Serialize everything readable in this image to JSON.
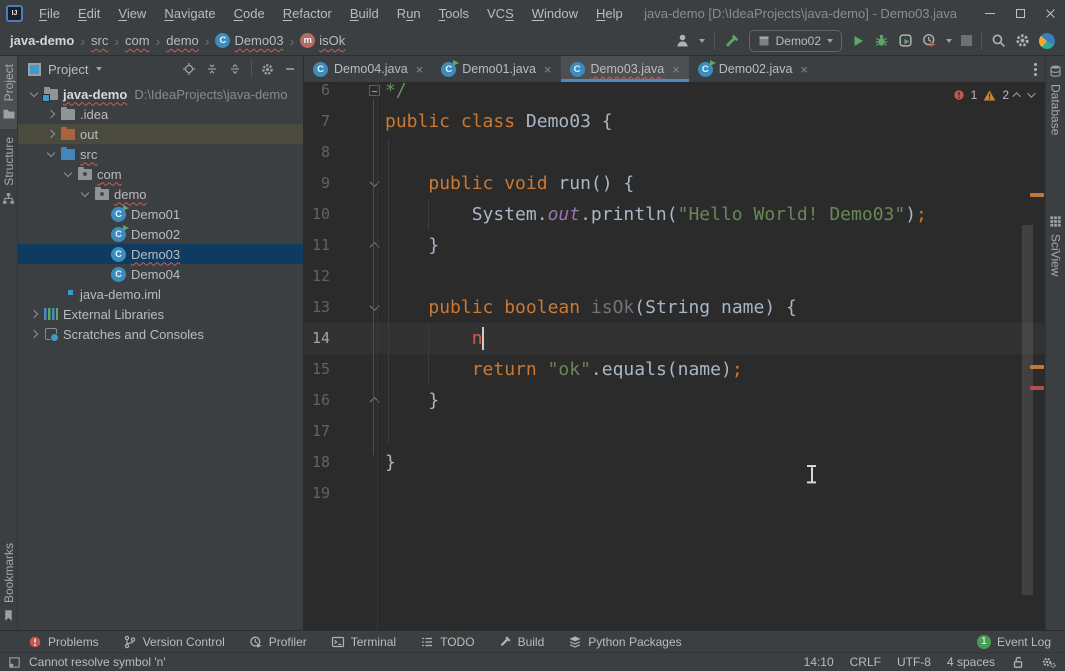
{
  "window": {
    "title": "java-demo [D:\\IdeaProjects\\java-demo] - Demo03.java"
  },
  "menu": {
    "items": [
      {
        "label": "File",
        "m": 0
      },
      {
        "label": "Edit",
        "m": 0
      },
      {
        "label": "View",
        "m": 0
      },
      {
        "label": "Navigate",
        "m": 0
      },
      {
        "label": "Code",
        "m": 0
      },
      {
        "label": "Refactor",
        "m": 0
      },
      {
        "label": "Build",
        "m": 0
      },
      {
        "label": "Run",
        "m": 1
      },
      {
        "label": "Tools",
        "m": 0
      },
      {
        "label": "VCS",
        "m": 2
      },
      {
        "label": "Window",
        "m": 0
      },
      {
        "label": "Help",
        "m": 0
      }
    ]
  },
  "breadcrumbs": [
    {
      "label": "java-demo",
      "bold": true
    },
    {
      "label": "src",
      "sq": true
    },
    {
      "label": "com",
      "sq": true
    },
    {
      "label": "demo",
      "sq": true
    },
    {
      "label": "Demo03",
      "icon": "class",
      "sq": true
    },
    {
      "label": "isOk",
      "icon": "method",
      "sq": true
    }
  ],
  "toolbar": {
    "run_config": "Demo02"
  },
  "left_stripe": {
    "top": [
      {
        "label": "Project",
        "icon": "project-tool",
        "active": true
      },
      {
        "label": "Structure",
        "icon": "structure"
      }
    ],
    "bottom": [
      {
        "label": "Bookmarks",
        "icon": "bookmarks"
      }
    ]
  },
  "right_stripe": [
    {
      "label": "Database",
      "icon": "database"
    },
    {
      "label": "SciView",
      "icon": "grid"
    }
  ],
  "project_panel": {
    "title": "Project",
    "tree": [
      {
        "label": "java-demo",
        "level": 0,
        "chevron": "open",
        "icon": "project",
        "bold": true,
        "sq": true,
        "suffix": "D:\\IdeaProjects\\java-demo"
      },
      {
        "label": ".idea",
        "level": 1,
        "chevron": "closed",
        "icon": "folder"
      },
      {
        "label": "out",
        "level": 1,
        "chevron": "closed",
        "icon": "folder-excluded",
        "highlight": true
      },
      {
        "label": "src",
        "level": 1,
        "chevron": "open",
        "icon": "folder-source",
        "sq": true
      },
      {
        "label": "com",
        "level": 2,
        "chevron": "open",
        "icon": "package",
        "sq": true
      },
      {
        "label": "demo",
        "level": 3,
        "chevron": "open",
        "icon": "package",
        "sq": true
      },
      {
        "label": "Demo01",
        "level": 4,
        "icon": "class-run"
      },
      {
        "label": "Demo02",
        "level": 4,
        "icon": "class-run"
      },
      {
        "label": "Demo03",
        "level": 4,
        "icon": "class",
        "selected": true,
        "sq": true
      },
      {
        "label": "Demo04",
        "level": 4,
        "icon": "class"
      },
      {
        "label": "java-demo.iml",
        "level": 1,
        "icon": "iml"
      },
      {
        "label": "External Libraries",
        "level": 0,
        "chevron": "closed",
        "icon": "libraries"
      },
      {
        "label": "Scratches and Consoles",
        "level": 0,
        "chevron": "closed",
        "icon": "scratches"
      }
    ]
  },
  "tabs": [
    {
      "label": "Demo04.java",
      "icon": "class"
    },
    {
      "label": "Demo01.java",
      "icon": "class-run"
    },
    {
      "label": "Demo03.java",
      "icon": "class",
      "active": true,
      "sq": true
    },
    {
      "label": "Demo02.java",
      "icon": "class-run"
    }
  ],
  "editor": {
    "inspection": {
      "errors": "1",
      "warnings": "2"
    },
    "lines": [
      {
        "no": "6",
        "fold": "box",
        "segs": [
          [
            "cmt",
            "*/"
          ]
        ]
      },
      {
        "no": "7",
        "segs": [
          [
            "kw",
            "public class "
          ],
          [
            "def",
            "Demo03 {"
          ]
        ]
      },
      {
        "no": "8",
        "segs": []
      },
      {
        "no": "9",
        "fold": "open",
        "segs": [
          [
            "def",
            "    "
          ],
          [
            "kw",
            "public void "
          ],
          [
            "def",
            "run() {"
          ]
        ]
      },
      {
        "no": "10",
        "segs": [
          [
            "def",
            "        System."
          ],
          [
            "field",
            "out"
          ],
          [
            "def",
            ".println("
          ],
          [
            "str",
            "\"Hello World! Demo03\""
          ],
          [
            "def",
            ")"
          ],
          [
            "semi",
            ";"
          ]
        ]
      },
      {
        "no": "11",
        "fold": "close",
        "segs": [
          [
            "def",
            "    }"
          ]
        ]
      },
      {
        "no": "12",
        "segs": []
      },
      {
        "no": "13",
        "fold": "open",
        "segs": [
          [
            "def",
            "    "
          ],
          [
            "kw",
            "public boolean "
          ],
          [
            "unused",
            "isOk"
          ],
          [
            "def",
            "(String name) {"
          ]
        ]
      },
      {
        "no": "14",
        "current": true,
        "caret": true,
        "segs": [
          [
            "def",
            "        "
          ],
          [
            "err",
            "n"
          ]
        ]
      },
      {
        "no": "15",
        "segs": [
          [
            "def",
            "        "
          ],
          [
            "kw",
            "return "
          ],
          [
            "str",
            "\"ok\""
          ],
          [
            "def",
            ".equals(name)"
          ],
          [
            "semi",
            ";"
          ]
        ]
      },
      {
        "no": "16",
        "fold": "close",
        "segs": [
          [
            "def",
            "    }"
          ]
        ]
      },
      {
        "no": "17",
        "segs": []
      },
      {
        "no": "18",
        "segs": [
          [
            "def",
            "}"
          ]
        ]
      },
      {
        "no": "19",
        "segs": []
      }
    ]
  },
  "bottom_bar": {
    "items": [
      {
        "label": "Problems",
        "icon": "problems"
      },
      {
        "label": "Version Control",
        "icon": "branch"
      },
      {
        "label": "Profiler",
        "icon": "clock"
      },
      {
        "label": "Terminal",
        "icon": "terminal"
      },
      {
        "label": "TODO",
        "icon": "todo"
      },
      {
        "label": "Build",
        "icon": "hammer-gray"
      },
      {
        "label": "Python Packages",
        "icon": "layers"
      }
    ],
    "event_log": {
      "label": "Event Log",
      "badge": "1"
    }
  },
  "status_bar": {
    "message": "Cannot resolve symbol 'n'",
    "items": [
      "14:10",
      "CRLF",
      "UTF-8",
      "4 spaces"
    ]
  },
  "colors": {
    "accent_blue": "#4A88C7",
    "error_red": "#C75450",
    "warning_orange": "#D0862F",
    "run_green": "#59A869",
    "selection_navy": "#0F3B61",
    "editor_bg": "#2B2B2B",
    "panel_bg": "#3C3F41"
  }
}
